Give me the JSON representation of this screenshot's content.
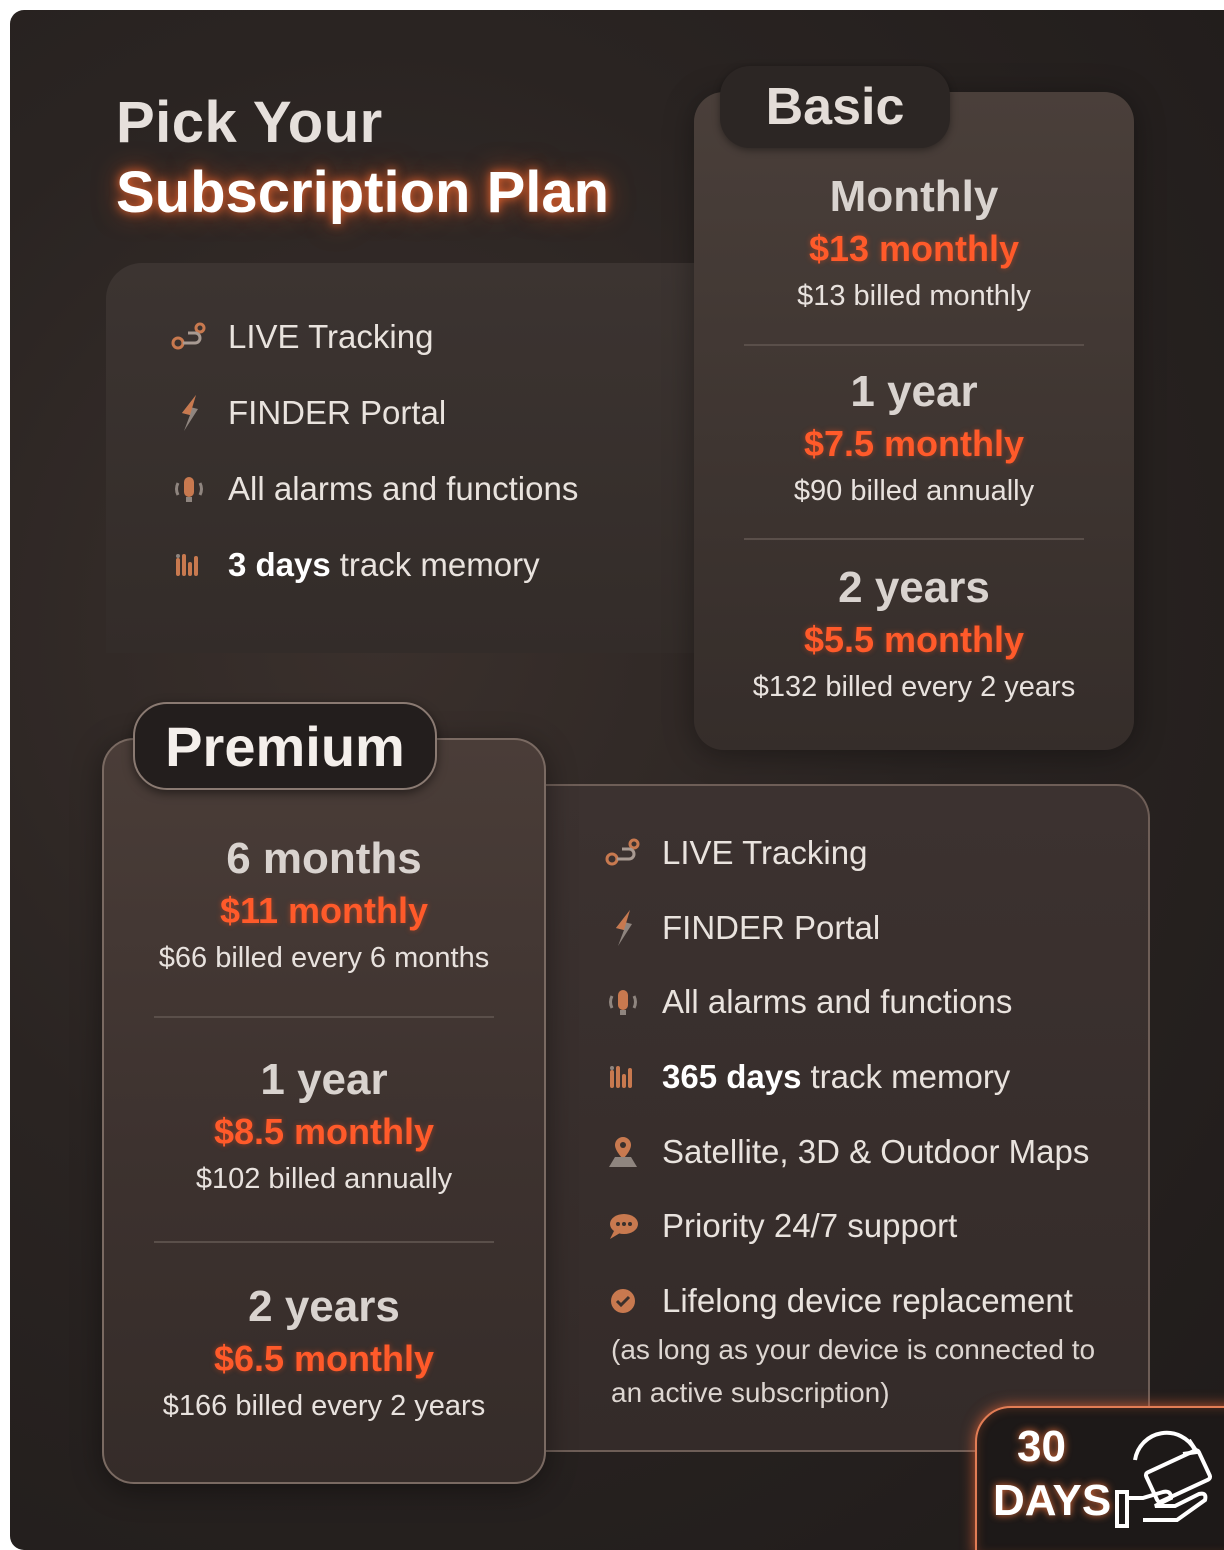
{
  "headline": {
    "line1": "Pick Your",
    "line2": "Subscription Plan"
  },
  "basic": {
    "tab_label": "Basic",
    "features": [
      {
        "icon": "route-icon",
        "bold": "",
        "text": "LIVE Tracking"
      },
      {
        "icon": "lightning-icon",
        "bold": "",
        "text": "FINDER Portal"
      },
      {
        "icon": "alarm-bell-icon",
        "bold": "",
        "text": "All alarms and functions"
      },
      {
        "icon": "track-memory-icon",
        "bold": "3 days",
        "text": "track memory"
      }
    ],
    "plans": [
      {
        "term": "Monthly",
        "price": "$13 monthly",
        "billed": "$13 billed monthly"
      },
      {
        "term": "1 year",
        "price": "$7.5 monthly",
        "billed": "$90 billed annually"
      },
      {
        "term": "2 years",
        "price": "$5.5 monthly",
        "billed": "$132 billed every 2 years"
      }
    ]
  },
  "premium": {
    "tab_label": "Premium",
    "plans": [
      {
        "term": "6 months",
        "price": "$11 monthly",
        "billed": "$66 billed every 6 months"
      },
      {
        "term": "1 year",
        "price": "$8.5 monthly",
        "billed": "$102 billed annually"
      },
      {
        "term": "2 years",
        "price": "$6.5 monthly",
        "billed": "$166 billed every 2 years"
      }
    ],
    "features": [
      {
        "icon": "route-icon",
        "bold": "",
        "text": "LIVE Tracking"
      },
      {
        "icon": "lightning-icon",
        "bold": "",
        "text": "FINDER Portal"
      },
      {
        "icon": "alarm-bell-icon",
        "bold": "",
        "text": "All alarms and functions"
      },
      {
        "icon": "track-memory-icon",
        "bold": "365 days",
        "text": "track memory"
      },
      {
        "icon": "map-pin-icon",
        "bold": "",
        "text": "Satellite, 3D & Outdoor Maps"
      },
      {
        "icon": "support-chat-icon",
        "bold": "",
        "text": "Priority 24/7 support"
      },
      {
        "icon": "verified-badge-icon",
        "bold": "",
        "text": "Lifelong device replacement"
      }
    ],
    "note_line1": "(as long as your device is connected to",
    "note_line2": "an active subscription)"
  },
  "guarantee": {
    "number": "30",
    "unit": "DAYS",
    "icon": "money-back-hand-icon"
  },
  "colors": {
    "accent": "#ff5a2a",
    "background": "#2a2422",
    "text": "#ece6e1"
  }
}
